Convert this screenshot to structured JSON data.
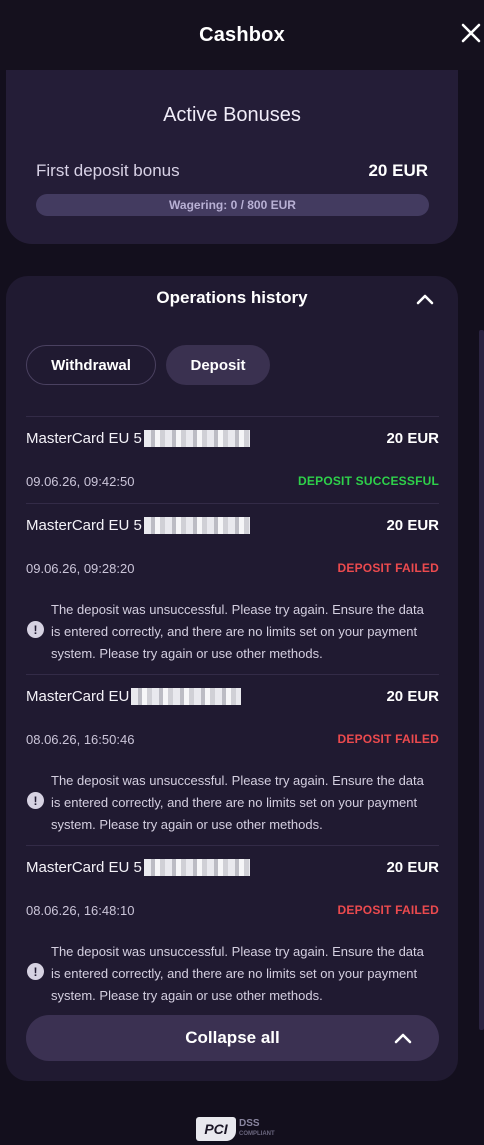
{
  "header": {
    "title": "Cashbox"
  },
  "bonuses": {
    "heading": "Active Bonuses",
    "items": [
      {
        "name": "First deposit bonus",
        "amount": "20 EUR",
        "wagering_label": "Wagering: 0 / 800 EUR",
        "wagering_progress": 0
      }
    ]
  },
  "operations": {
    "title": "Operations history",
    "tabs": [
      {
        "label": "Withdrawal",
        "active": false
      },
      {
        "label": "Deposit",
        "active": true
      }
    ],
    "items": [
      {
        "method": "MasterCard EU 5",
        "amount": "20 EUR",
        "date": "09.06.26, 09:42:50",
        "status": "DEPOSIT SUCCESSFUL",
        "status_type": "success",
        "note": ""
      },
      {
        "method": "MasterCard EU 5",
        "amount": "20 EUR",
        "date": "09.06.26, 09:28:20",
        "status": "DEPOSIT FAILED",
        "status_type": "failed",
        "note": "The deposit was unsuccessful. Please try again. Ensure the data is entered correctly, and there are no limits set on your payment system. Please try again or use other methods."
      },
      {
        "method": "MasterCard EU",
        "amount": "20 EUR",
        "date": "08.06.26, 16:50:46",
        "status": "DEPOSIT FAILED",
        "status_type": "failed",
        "note": "The deposit was unsuccessful. Please try again. Ensure the data is entered correctly, and there are no limits set on your payment system. Please try again or use other methods."
      },
      {
        "method": "MasterCard EU 5",
        "amount": "20 EUR",
        "date": "08.06.26, 16:48:10",
        "status": "DEPOSIT FAILED",
        "status_type": "failed",
        "note": "The deposit was unsuccessful. Please try again. Ensure the data is entered correctly, and there are no limits set on your payment system. Please try again or use other methods."
      }
    ],
    "collapse_label": "Collapse all"
  },
  "footer": {
    "badge_main": "PCI",
    "badge_sub": "DSS",
    "badge_tiny": "COMPLIANT"
  },
  "colors": {
    "success": "#2ed04a",
    "failed": "#ec4a4e",
    "panel": "#201a31",
    "accent": "#3b3152"
  },
  "icons": {
    "close": "close-icon",
    "chevron_up": "chevron-up-icon",
    "info": "exclamation-icon"
  }
}
